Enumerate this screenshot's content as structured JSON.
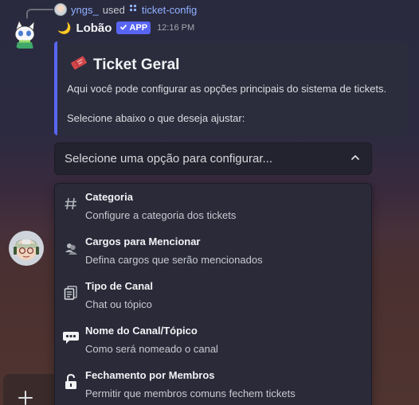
{
  "reply": {
    "username": "yngs_",
    "used_text": "used",
    "command_icon": "slash-command-icon",
    "command": "ticket-config"
  },
  "message": {
    "emoji": "🌙",
    "bot_name": "Lobão",
    "badge": "APP",
    "badge_icon": "check-icon",
    "timestamp": "12:16 PM"
  },
  "embed": {
    "accent_color": "#5865f2",
    "title_icon": "ticket-icon",
    "title": "Ticket Geral",
    "description_1": "Aqui você pode configurar as opções principais do sistema de tickets.",
    "description_2": "Selecione abaixo o que deseja ajustar:"
  },
  "select": {
    "placeholder": "Selecione uma opção para configurar...",
    "expanded": true
  },
  "options": [
    {
      "icon": "hash-icon",
      "label": "Categoria",
      "description": "Configure a categoria dos tickets"
    },
    {
      "icon": "users-icon",
      "label": "Cargos para Mencionar",
      "description": "Defina cargos que serão mencionados"
    },
    {
      "icon": "documents-icon",
      "label": "Tipo de Canal",
      "description": "Chat ou tópico"
    },
    {
      "icon": "speech-bubble-icon",
      "label": "Nome do Canal/Tópico",
      "description": "Como será nomeado o canal"
    },
    {
      "icon": "lock-icon",
      "label": "Fechamento por Membros",
      "description": "Permitir que membros comuns fechem tickets"
    }
  ],
  "composer": {
    "icon": "plus-icon"
  }
}
